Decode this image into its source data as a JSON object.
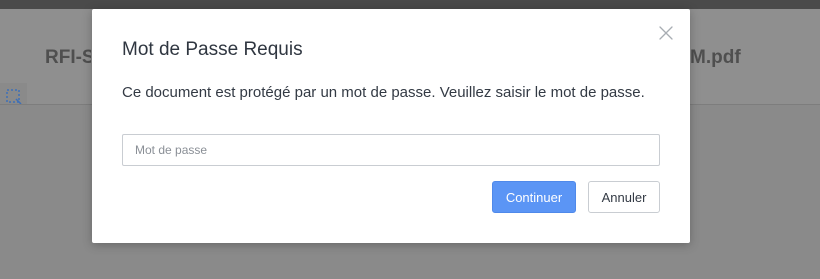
{
  "background": {
    "doc_title_left": "RFI-S",
    "doc_title_right": "M.pdf"
  },
  "modal": {
    "title": "Mot de Passe Requis",
    "message": "Ce document est protégé par un mot de passe. Veuillez saisir le mot de passe.",
    "password_placeholder": "Mot de passe",
    "password_value": "",
    "continue_label": "Continuer",
    "cancel_label": "Annuler",
    "close_icon": "close-icon"
  },
  "colors": {
    "primary": "#5b95f5",
    "overlay": "#8e8e8e",
    "title_text": "#2f3640"
  }
}
